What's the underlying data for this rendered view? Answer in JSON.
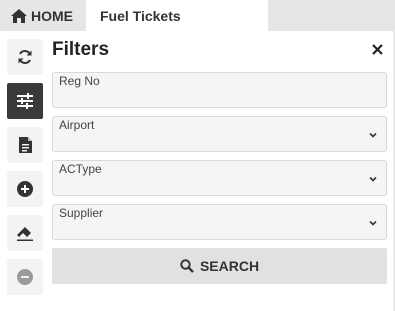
{
  "tabs": {
    "home_label": "HOME",
    "active_label": "Fuel Tickets"
  },
  "sidebar": {
    "items": [
      {
        "icon": "refresh-icon",
        "active": false
      },
      {
        "icon": "filter-sliders-icon",
        "active": true
      },
      {
        "icon": "document-icon",
        "active": false
      },
      {
        "icon": "add-circle-icon",
        "active": false
      },
      {
        "icon": "eraser-icon",
        "active": false
      },
      {
        "icon": "remove-circle-icon",
        "active": false
      }
    ]
  },
  "filters": {
    "title": "Filters",
    "close_icon": "close-icon",
    "fields": [
      {
        "label": "Reg No",
        "type": "text",
        "value": ""
      },
      {
        "label": "Airport",
        "type": "select",
        "value": ""
      },
      {
        "label": "ACType",
        "type": "select",
        "value": ""
      },
      {
        "label": "Supplier",
        "type": "select",
        "value": ""
      }
    ],
    "search_label": "SEARCH",
    "search_icon": "search-icon"
  },
  "colors": {
    "topbar_bg": "#e6e6e6",
    "active_sidebar_bg": "#3a3a3a",
    "field_bg": "#f5f5f5",
    "button_bg": "#e1e1e1"
  }
}
